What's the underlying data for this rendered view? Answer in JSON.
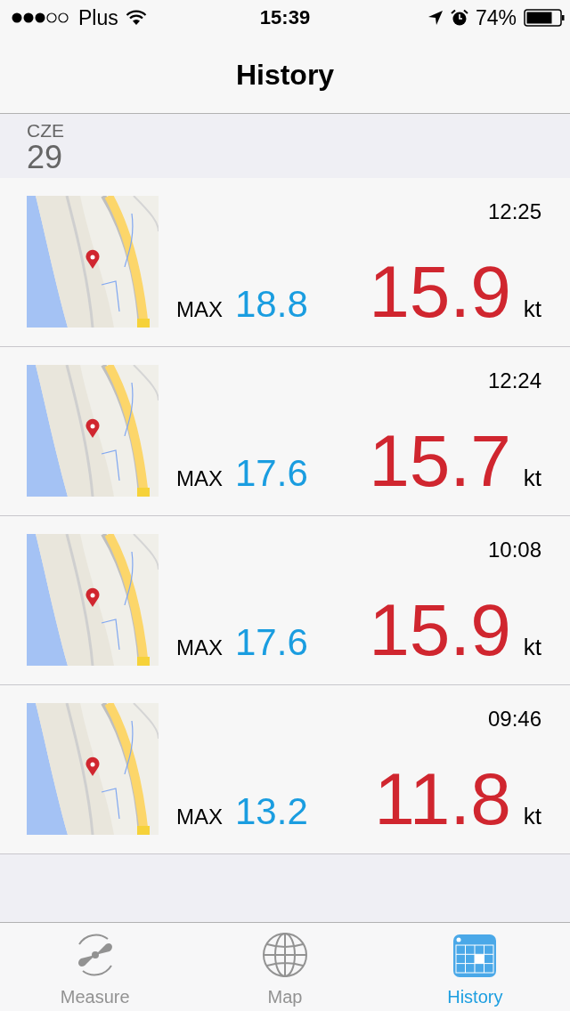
{
  "status_bar": {
    "carrier": "Plus",
    "time": "15:39",
    "battery": "74%"
  },
  "nav": {
    "title": "History"
  },
  "section": {
    "month": "CZE",
    "day": "29"
  },
  "entries": [
    {
      "time": "12:25",
      "max_label": "MAX",
      "max": "18.8",
      "speed": "15.9",
      "unit": "kt"
    },
    {
      "time": "12:24",
      "max_label": "MAX",
      "max": "17.6",
      "speed": "15.7",
      "unit": "kt"
    },
    {
      "time": "10:08",
      "max_label": "MAX",
      "max": "17.6",
      "speed": "15.9",
      "unit": "kt"
    },
    {
      "time": "09:46",
      "max_label": "MAX",
      "max": "13.2",
      "speed": "11.8",
      "unit": "kt"
    }
  ],
  "tabs": [
    {
      "label": "Measure",
      "selected": false
    },
    {
      "label": "Map",
      "selected": false
    },
    {
      "label": "History",
      "selected": true
    }
  ]
}
